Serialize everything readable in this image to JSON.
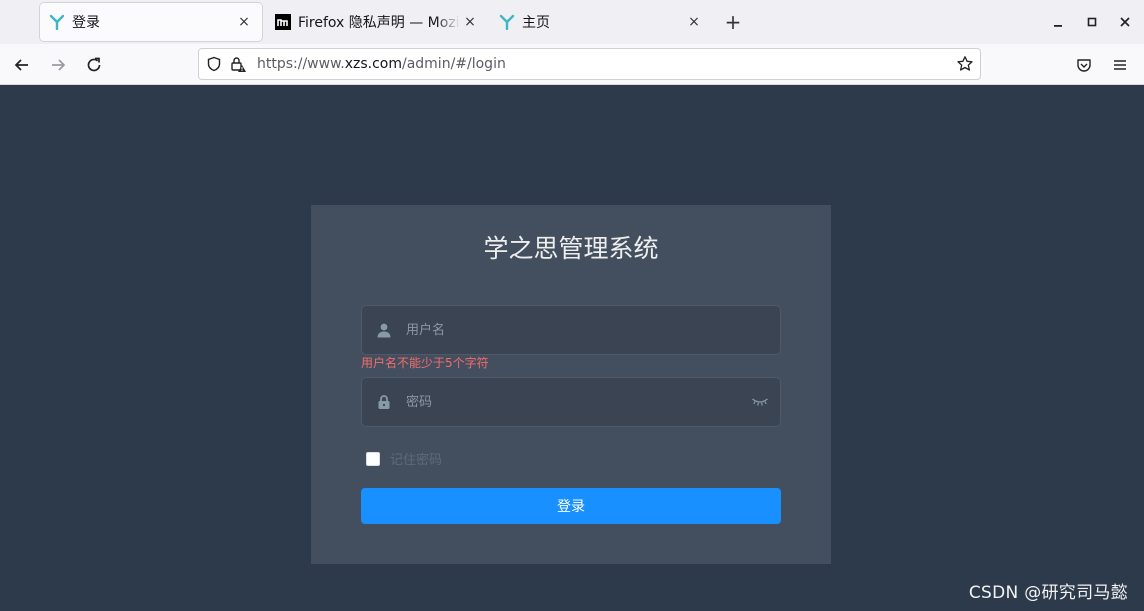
{
  "browser": {
    "tabs": [
      {
        "title": "登录",
        "active": true,
        "favicon": "y-logo-icon"
      },
      {
        "title": "Firefox 隐私声明 — Mozilla",
        "active": false,
        "favicon": "mozilla-m-icon"
      },
      {
        "title": "主页",
        "active": false,
        "favicon": "y-logo-icon"
      }
    ],
    "new_tab_symbol": "+",
    "close_symbol": "×",
    "url": {
      "prefix": "https://www.",
      "domain": "xzs.com",
      "path": "/admin/#/login"
    }
  },
  "login": {
    "title": "学之思管理系统",
    "username_placeholder": "用户名",
    "username_value": "",
    "username_error": "用户名不能少于5个字符",
    "password_placeholder": "密码",
    "password_value": "",
    "remember_label": "记住密码",
    "remember_checked": false,
    "submit_label": "登录"
  },
  "watermark": "CSDN @研究司马懿",
  "colors": {
    "page_bg": "#2d3a4b",
    "card_bg": "#434f5f",
    "input_bg": "#3b4452",
    "primary": "#1890ff",
    "error": "#f56c6c"
  }
}
